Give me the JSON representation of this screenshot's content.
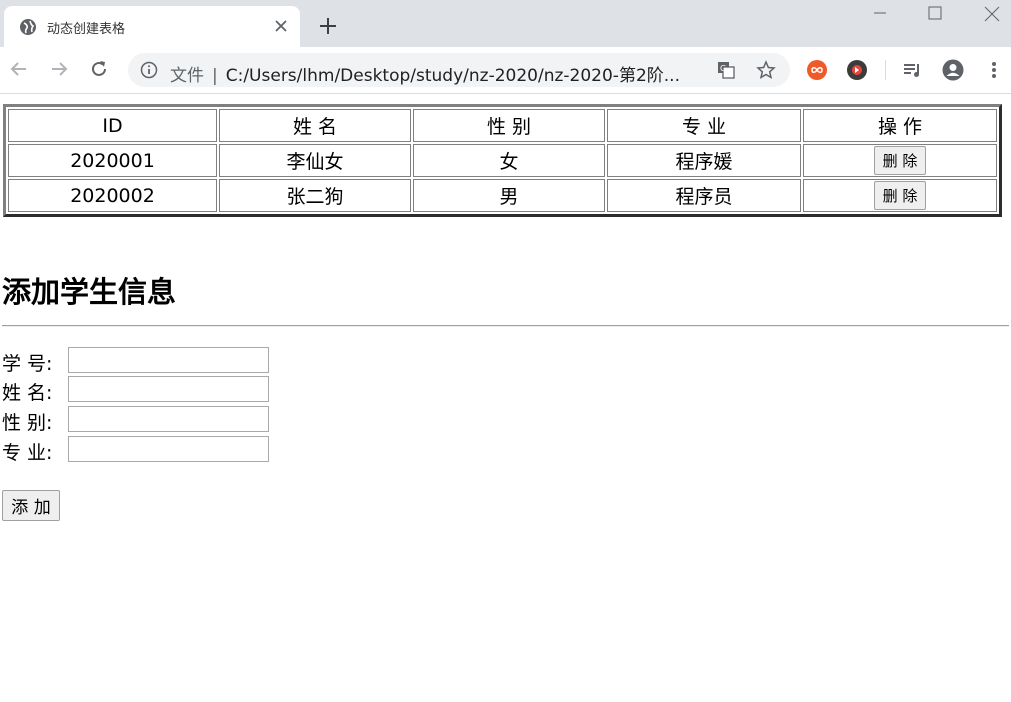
{
  "browser": {
    "tab_title": "动态创建表格",
    "url_scheme_label": "文件",
    "url_separator": "|",
    "url": "C:/Users/lhm/Desktop/study/nz-2020/nz-2020-第2阶..."
  },
  "table": {
    "headers": [
      "ID",
      "姓 名",
      "性 别",
      "专 业",
      "操 作"
    ],
    "rows": [
      {
        "id": "2020001",
        "name": "李仙女",
        "gender": "女",
        "major": "程序媛",
        "action": "删 除"
      },
      {
        "id": "2020002",
        "name": "张二狗",
        "gender": "男",
        "major": "程序员",
        "action": "删 除"
      }
    ]
  },
  "form": {
    "title": "添加学生信息",
    "fields": [
      {
        "label": "学 号:",
        "value": ""
      },
      {
        "label": "姓 名:",
        "value": ""
      },
      {
        "label": "性 别:",
        "value": ""
      },
      {
        "label": "专 业:",
        "value": ""
      }
    ],
    "submit_label": "添 加"
  },
  "icons": {
    "favicon": "globe-icon",
    "tab_close": "close-icon",
    "new_tab": "plus-icon",
    "back": "back-arrow-icon",
    "forward": "forward-arrow-icon",
    "reload": "reload-icon",
    "site_info": "info-icon",
    "translate": "translate-icon",
    "bookmark": "star-icon",
    "extensions": [
      "infinity-extension-icon",
      "audio-extension-icon"
    ],
    "media": "playlist-icon",
    "profile": "avatar-icon",
    "menu": "kebab-menu-icon"
  },
  "colors": {
    "tabstrip": "#dee1e6",
    "omnibox": "#f1f3f4",
    "table_border": "#808080",
    "button_bg": "#efefef"
  }
}
